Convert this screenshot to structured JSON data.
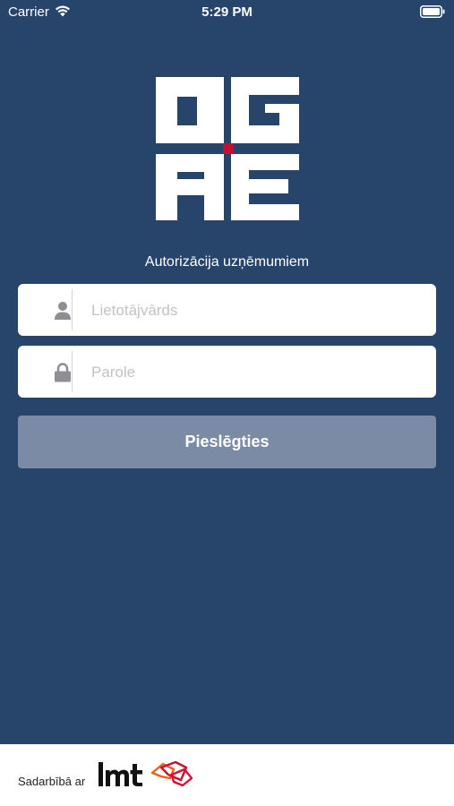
{
  "status_bar": {
    "carrier": "Carrier",
    "time": "5:29 PM",
    "wifi_icon": "wifi-icon",
    "battery_icon": "battery-icon"
  },
  "logo": {
    "text": "OGRE",
    "accent_color": "#c8102e"
  },
  "login": {
    "subtitle": "Autorizācija uzņēmumiem",
    "username_placeholder": "Lietotājvārds",
    "username_value": "",
    "username_icon": "user-icon",
    "password_placeholder": "Parole",
    "password_value": "",
    "password_icon": "lock-icon",
    "submit_label": "Pieslēgties"
  },
  "footer": {
    "label": "Sadarbībā ar",
    "partner_logo": "LMT"
  },
  "colors": {
    "background": "#27446b",
    "button": "#7b8ba5",
    "field": "#ffffff"
  }
}
